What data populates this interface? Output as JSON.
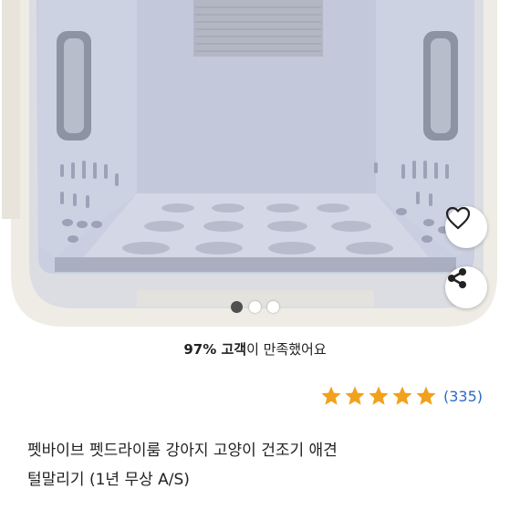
{
  "carousel": {
    "page_count": 3,
    "active_index": 0
  },
  "buttons": {
    "like_icon": "heart-outline-icon",
    "share_icon": "share-icon"
  },
  "satisfaction": {
    "percent_customers": "97% 고객",
    "rest": "이 만족했어요"
  },
  "rating": {
    "stars": 5,
    "star_color": "#f2a11c",
    "review_count": "(335)"
  },
  "product": {
    "title_line1": "펫바이브 펫드라이룸 강아지 고양이 건조기 애견",
    "title_line2": "털말리기 (1년 무상 A/S)"
  }
}
